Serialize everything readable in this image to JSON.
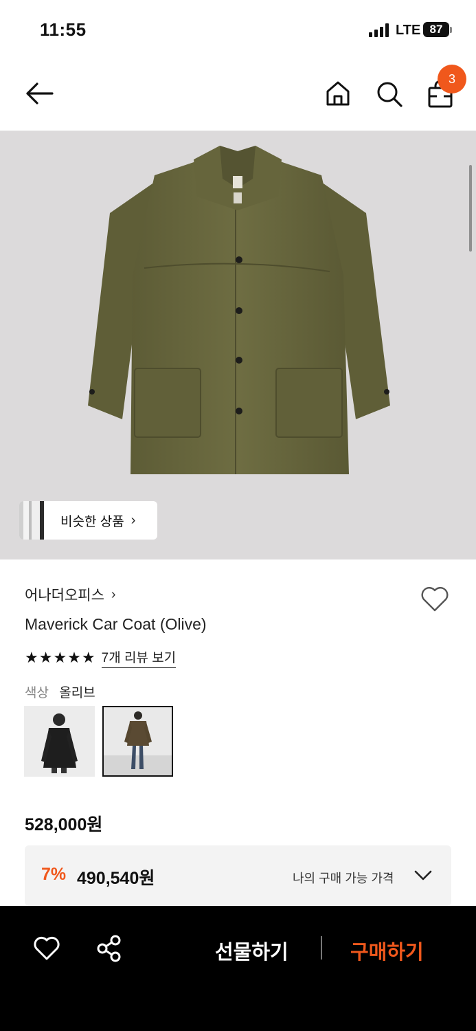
{
  "status_bar": {
    "time": "11:55",
    "network": "LTE",
    "battery": "87"
  },
  "header": {
    "cart_count": "3",
    "icons": [
      "back-arrow-icon",
      "home-icon",
      "search-icon",
      "shopping-bag-icon"
    ]
  },
  "hero": {
    "similar_label": "비슷한 상품",
    "similar_chevron": "›"
  },
  "product": {
    "brand": "어나더오피스",
    "brand_chevron": "›",
    "name": "Maverick Car Coat (Olive)",
    "stars": "★★★★★",
    "review_link": "7개 리뷰 보기",
    "color_label": "색상",
    "color_value": "올리브",
    "price": "528,000원"
  },
  "coupon": {
    "rate": "7%",
    "price": "490,540원",
    "label": "나의 구매 가능 가격"
  },
  "bottom_bar": {
    "gift_label": "선물하기",
    "buy_label": "구매하기"
  },
  "colors": {
    "accent": "#f0581c",
    "coat": "#6b6a3f",
    "image_bg": "#dcdadb",
    "bottom_bar": "#000000"
  }
}
